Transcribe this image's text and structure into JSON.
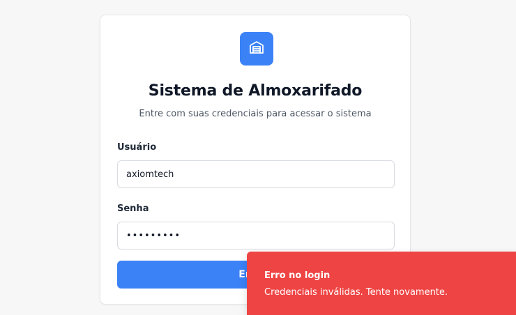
{
  "app": {
    "title": "Sistema de Almoxarifado",
    "subtitle": "Entre com suas credenciais para acessar o sistema",
    "logo_icon": "warehouse-icon"
  },
  "form": {
    "username_label": "Usuário",
    "username_value": "axiomtech",
    "password_label": "Senha",
    "password_value": "•••••••••",
    "submit_label": "Entrar"
  },
  "toast": {
    "title": "Erro no login",
    "message": "Credenciais inválidas. Tente novamente."
  },
  "colors": {
    "accent": "#3b82f6",
    "error": "#ef4444",
    "background": "#f7f7f7"
  }
}
